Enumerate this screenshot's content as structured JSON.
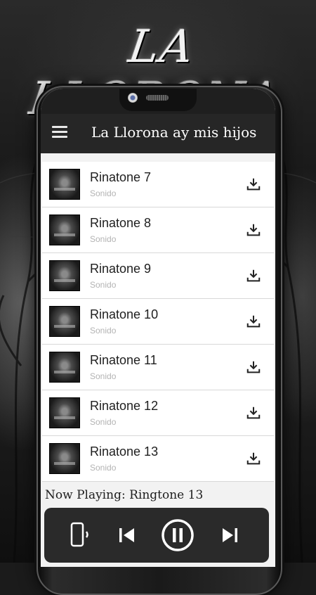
{
  "banner": {
    "title": "LA LLORONA"
  },
  "appbar": {
    "title": "La Llorona ay mis hijos",
    "menu_icon": "hamburger-menu-icon"
  },
  "list": {
    "items": [
      {
        "name": "Rinatone 7",
        "subtitle": "Sonido"
      },
      {
        "name": "Rinatone 8",
        "subtitle": "Sonido"
      },
      {
        "name": "Rinatone 9",
        "subtitle": "Sonido"
      },
      {
        "name": "Rinatone 10",
        "subtitle": "Sonido"
      },
      {
        "name": "Rinatone 11",
        "subtitle": "Sonido"
      },
      {
        "name": "Rinatone 12",
        "subtitle": "Sonido"
      },
      {
        "name": "Rinatone 13",
        "subtitle": "Sonido"
      }
    ],
    "item_action_icon": "download-icon"
  },
  "player": {
    "now_playing": "Now Playing: Ringtone 13",
    "controls": [
      "phone-vibrate-icon",
      "skip-previous-icon",
      "pause-icon",
      "skip-next-icon"
    ]
  },
  "colors": {
    "appbar": "#262626",
    "player": "#2a2a2a",
    "list_bg": "#ffffff",
    "screen_bg": "#f2f2f2"
  }
}
